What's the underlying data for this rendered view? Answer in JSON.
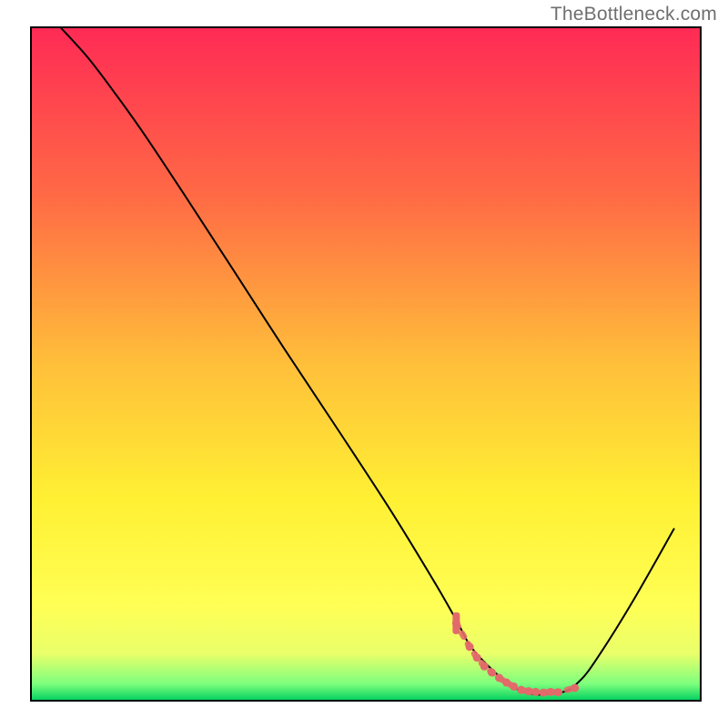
{
  "watermark": "TheBottleneck.com",
  "chart_data": {
    "type": "line",
    "title": "",
    "xlabel": "",
    "ylabel": "",
    "xlim": [
      0,
      100
    ],
    "ylim": [
      0,
      100
    ],
    "grid": false,
    "legend": false,
    "gradient": {
      "stops": [
        {
          "offset": 0.0,
          "color": "#ff2a55"
        },
        {
          "offset": 0.25,
          "color": "#ff6a45"
        },
        {
          "offset": 0.5,
          "color": "#ffbf3a"
        },
        {
          "offset": 0.7,
          "color": "#fff033"
        },
        {
          "offset": 0.86,
          "color": "#ffff55"
        },
        {
          "offset": 0.93,
          "color": "#e9ff6a"
        },
        {
          "offset": 0.975,
          "color": "#7dff7d"
        },
        {
          "offset": 1.0,
          "color": "#00d060"
        }
      ]
    },
    "series": [
      {
        "name": "bottleneck-curve",
        "stroke": "#000000",
        "stroke_width": 2,
        "x": [
          4.4,
          8.5,
          12.7,
          17.0,
          23.0,
          30.0,
          38.0,
          46.0,
          54.0,
          60.5,
          63.5,
          66.5,
          73.0,
          79.0,
          82.0,
          85.0,
          90.0,
          96.0
        ],
        "y": [
          100.0,
          95.5,
          90.0,
          84.0,
          75.0,
          64.3,
          52.0,
          40.0,
          27.8,
          17.2,
          12.0,
          7.0,
          1.5,
          1.2,
          3.0,
          7.0,
          15.0,
          25.5
        ]
      },
      {
        "name": "optimal-range-markers",
        "type": "scatter",
        "stroke": "#e36a6a",
        "fill": "#e36a6a",
        "marker_size": 9,
        "x": [
          63.5,
          65.5,
          66.6,
          67.7,
          68.8,
          69.9,
          71.0,
          72.1,
          73.2,
          74.3,
          75.4,
          76.5,
          77.6,
          78.7,
          81.2
        ],
        "y": [
          11.5,
          8.0,
          6.4,
          5.1,
          4.2,
          3.4,
          2.7,
          2.1,
          1.6,
          1.4,
          1.3,
          1.2,
          1.3,
          1.25,
          1.9
        ]
      }
    ]
  }
}
